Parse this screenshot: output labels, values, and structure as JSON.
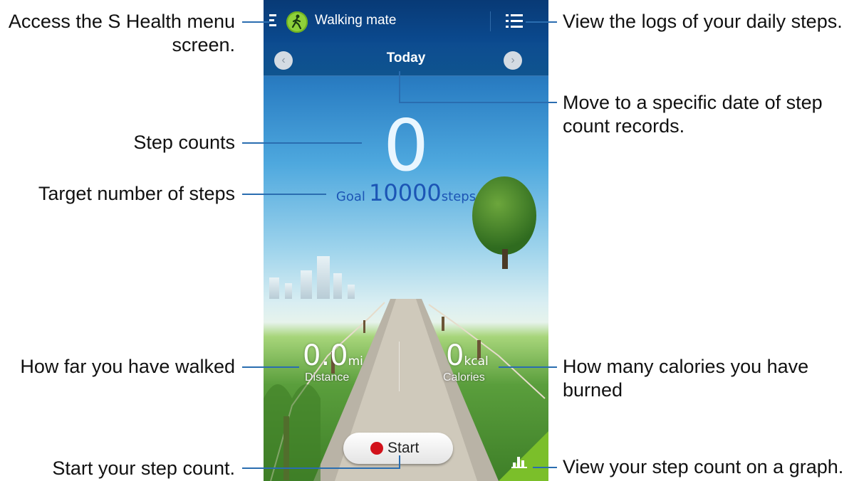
{
  "app": {
    "title": "Walking mate",
    "icons": {
      "menu": "menu-icon",
      "logo": "walking-figure-icon",
      "logs": "list-icon",
      "graph": "bar-graph-icon",
      "prev": "chevron-left-icon",
      "next": "chevron-right-icon",
      "record": "record-dot-icon"
    }
  },
  "date_nav": {
    "label": "Today",
    "prev_symbol": "‹",
    "next_symbol": "›"
  },
  "steps": {
    "count": "0",
    "goal_label": "Goal",
    "goal_value": "10000",
    "goal_unit": "steps"
  },
  "distance": {
    "value": "0.0",
    "unit": "mi",
    "label": "Distance"
  },
  "calories": {
    "value": "0",
    "unit": "kcal",
    "label": "Calories"
  },
  "start_button": {
    "label": "Start"
  },
  "annotations": {
    "menu_line1": "Access the S Health menu",
    "menu_line2": "screen.",
    "logs": "View the logs of your daily steps.",
    "date_line1": "Move to a specific date of step",
    "date_line2": "count records.",
    "step_counts": "Step counts",
    "target": "Target number of steps",
    "distance": "How far you have walked",
    "calories_line1": "How many calories you have",
    "calories_line2": "burned",
    "start": "Start your step count.",
    "graph": "View your step count on a graph."
  },
  "colors": {
    "accent_green": "#7bbf2a",
    "goal_blue": "#1c55b5",
    "topbar": "#0b4a8f",
    "leader": "#2a6db0",
    "record_red": "#d2121b"
  }
}
